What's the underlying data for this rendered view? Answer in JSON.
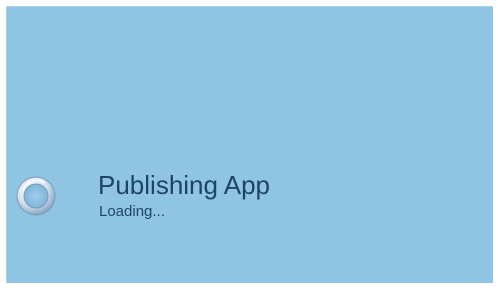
{
  "splash": {
    "app_name": "Publishing App",
    "status_text": "Loading...",
    "icon": "loading-ring-icon",
    "colors": {
      "background": "#8fc4e3",
      "text": "#1e4466"
    }
  }
}
